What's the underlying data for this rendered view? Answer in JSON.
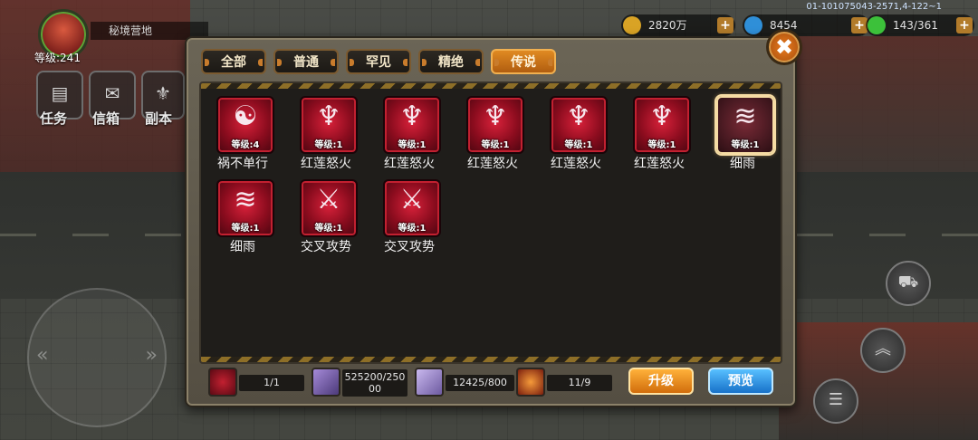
{
  "hud": {
    "base_name": "秘境营地",
    "player_level": "等级:241",
    "buttons": [
      {
        "label": "任务",
        "icon": "scroll-icon"
      },
      {
        "label": "信箱",
        "icon": "mailbox-icon"
      },
      {
        "label": "副本",
        "icon": "dungeon-icon"
      }
    ],
    "currencies": [
      {
        "value": "2820万",
        "icon": "gold-coin-icon",
        "color": "#d9a325"
      },
      {
        "value": "8454",
        "icon": "blue-gem-icon",
        "color": "#2f8fd8"
      },
      {
        "value": "143/361",
        "icon": "green-energy-icon",
        "color": "#3cc13a"
      }
    ],
    "build_id": "01-101075043-2571,4-122~1"
  },
  "panel": {
    "tabs": [
      {
        "label": "全部",
        "active": false
      },
      {
        "label": "普通",
        "active": false
      },
      {
        "label": "罕见",
        "active": false
      },
      {
        "label": "精绝",
        "active": false
      },
      {
        "label": "传说",
        "active": true
      }
    ],
    "close_label": "✖",
    "skills": [
      {
        "name": "祸不单行",
        "level": "等级:4",
        "icon": "yin-yang-icon",
        "selected": false
      },
      {
        "name": "红莲怒火",
        "level": "等级:1",
        "icon": "red-lotus-icon",
        "selected": false
      },
      {
        "name": "红莲怒火",
        "level": "等级:1",
        "icon": "red-lotus-icon",
        "selected": false
      },
      {
        "name": "红莲怒火",
        "level": "等级:1",
        "icon": "red-lotus-icon",
        "selected": false
      },
      {
        "name": "红莲怒火",
        "level": "等级:1",
        "icon": "red-lotus-icon",
        "selected": false
      },
      {
        "name": "红莲怒火",
        "level": "等级:1",
        "icon": "red-lotus-icon",
        "selected": false
      },
      {
        "name": "细雨",
        "level": "等级:1",
        "icon": "drizzle-icon",
        "selected": true
      },
      {
        "name": "细雨",
        "level": "等级:1",
        "icon": "drizzle-icon",
        "selected": false
      },
      {
        "name": "交叉攻势",
        "level": "等级:1",
        "icon": "crossed-blades-icon",
        "selected": false
      },
      {
        "name": "交叉攻势",
        "level": "等级:1",
        "icon": "crossed-blades-icon",
        "selected": false
      }
    ],
    "resources": [
      {
        "value": "1/1",
        "icon": "skill-card-icon"
      },
      {
        "value_line1": "525200/250",
        "value_line2": "00",
        "icon": "ticket-icon"
      },
      {
        "value": "12425/800",
        "icon": "book-icon"
      },
      {
        "value": "11/9",
        "icon": "fire-orb-icon"
      }
    ],
    "upgrade_label": "升级",
    "preview_label": "预览"
  }
}
